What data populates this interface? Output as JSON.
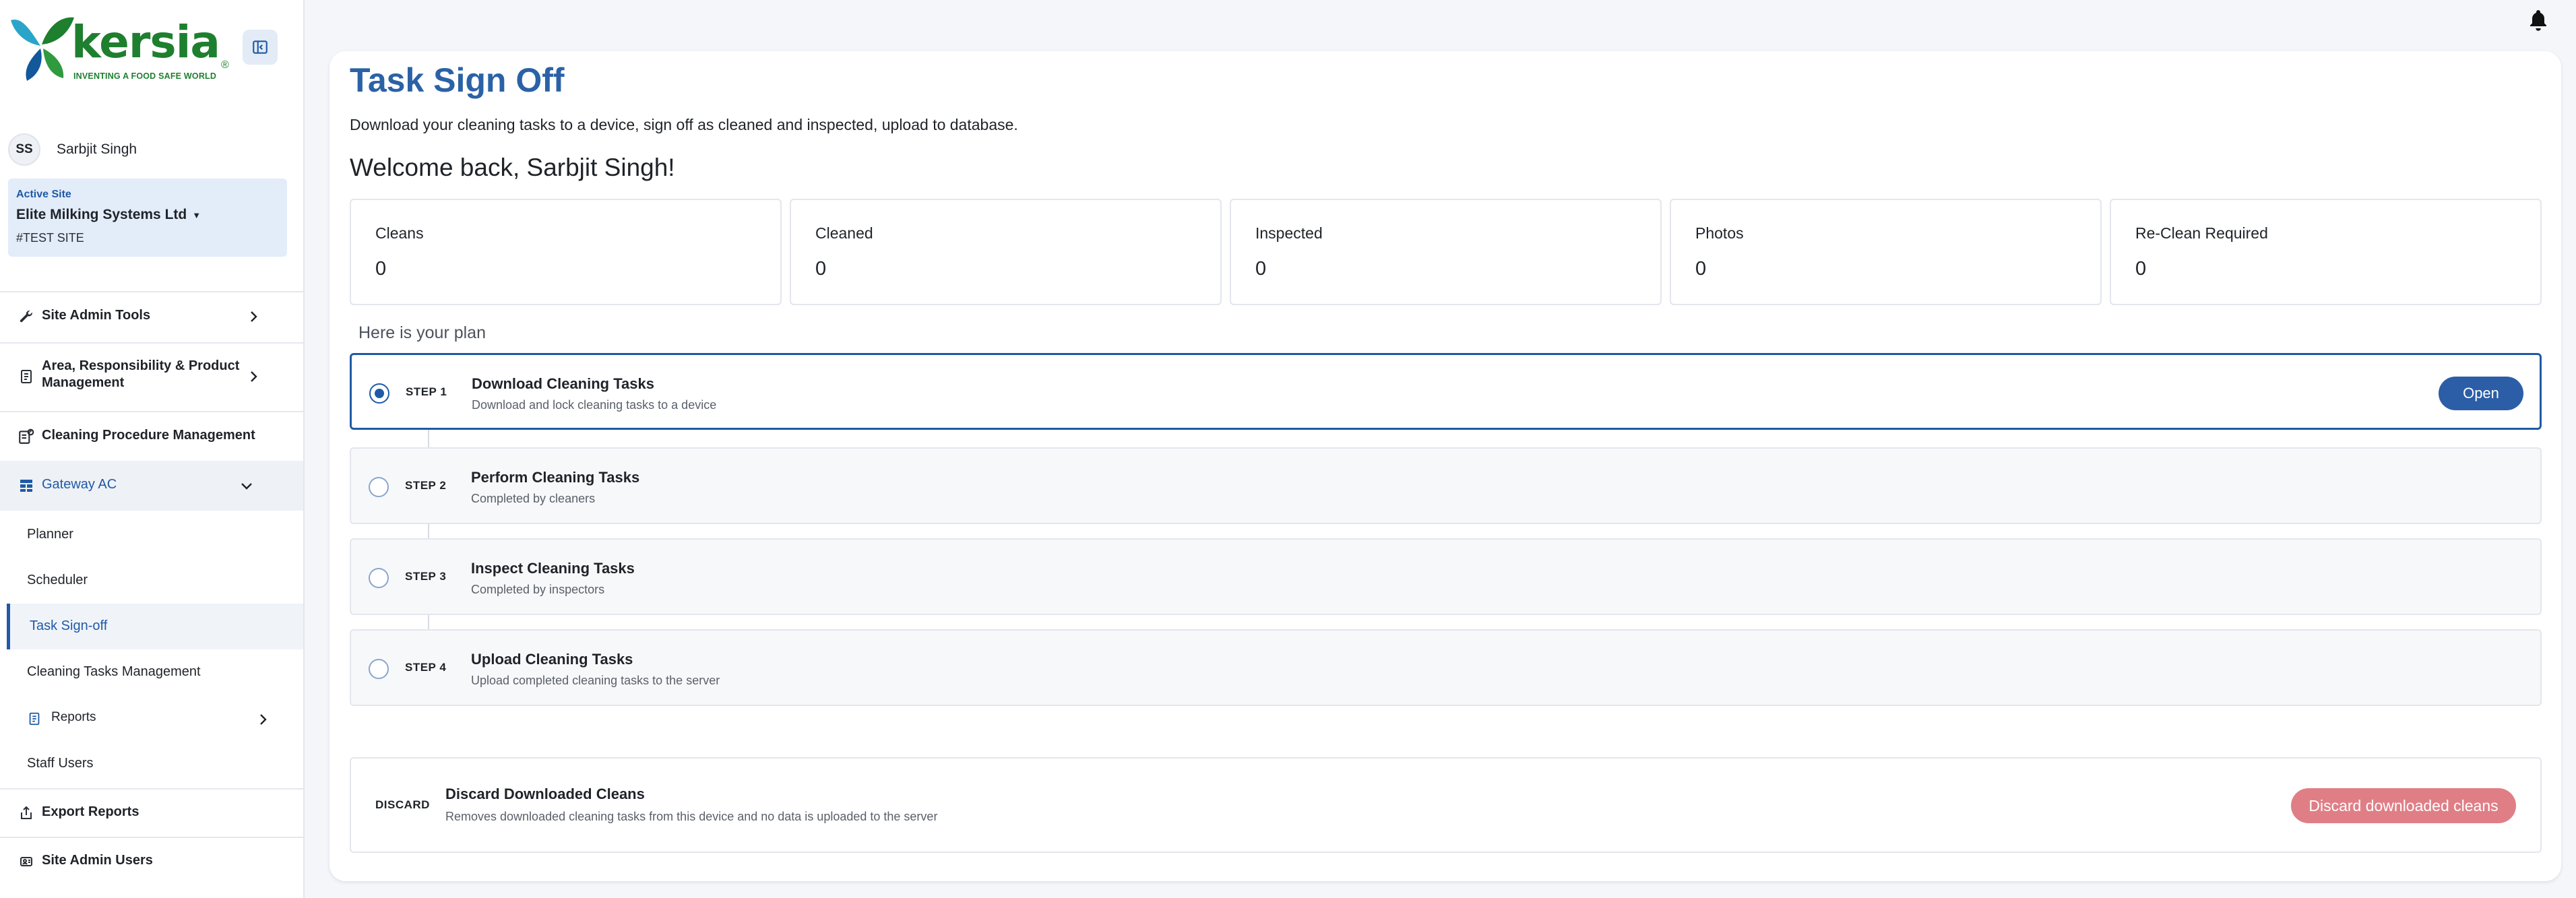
{
  "brand": {
    "logo_text": "kersia",
    "logo_reg": "®",
    "tagline": "INVENTING A FOOD SAFE WORLD",
    "colors": {
      "green": "#1e7f2f",
      "blue": "#1f5aa6",
      "leaf_light": "#2aa5c9",
      "leaf_dark": "#12589a"
    }
  },
  "sidebar": {
    "user": {
      "initials": "SS",
      "name": "Sarbjit Singh"
    },
    "site": {
      "label": "Active Site",
      "name": "Elite Milking Systems Ltd",
      "code": "#TEST SITE"
    },
    "items": [
      {
        "label": "Site Admin Tools",
        "icon": "wrench-icon"
      },
      {
        "label": "Area, Responsibility & Product",
        "label2": "Management",
        "icon": "document-icon"
      },
      {
        "label": "Cleaning Procedure Management",
        "icon": "procedure-icon"
      },
      {
        "label": "Gateway AC",
        "icon": "grid-icon"
      }
    ],
    "sub_items": [
      {
        "label": "Planner"
      },
      {
        "label": "Scheduler"
      },
      {
        "label": "Task Sign-off"
      },
      {
        "label": "Cleaning Tasks Management"
      },
      {
        "label": "Reports"
      },
      {
        "label": "Staff Users"
      }
    ],
    "bottom_items": [
      {
        "label": "Export Reports",
        "icon": "export-icon"
      },
      {
        "label": "Site Admin Users",
        "icon": "users-icon"
      }
    ]
  },
  "main": {
    "title": "Task Sign Off",
    "description": "Download your cleaning tasks to a device, sign off as cleaned and inspected, upload to database.",
    "welcome": "Welcome back, Sarbjit Singh!",
    "stats": [
      {
        "label": "Cleans",
        "value": "0"
      },
      {
        "label": "Cleaned",
        "value": "0"
      },
      {
        "label": "Inspected",
        "value": "0"
      },
      {
        "label": "Photos",
        "value": "0"
      },
      {
        "label": "Re-Clean Required",
        "value": "0"
      }
    ],
    "plan_label": "Here is your plan",
    "steps": [
      {
        "step": "STEP 1",
        "title": "Download Cleaning Tasks",
        "subtitle": "Download and lock cleaning tasks to a device",
        "action": "Open"
      },
      {
        "step": "STEP 2",
        "title": "Perform Cleaning Tasks",
        "subtitle": "Completed by cleaners"
      },
      {
        "step": "STEP 3",
        "title": "Inspect Cleaning Tasks",
        "subtitle": "Completed by inspectors"
      },
      {
        "step": "STEP 4",
        "title": "Upload Cleaning Tasks",
        "subtitle": "Upload completed cleaning tasks to the server"
      }
    ],
    "discard": {
      "tag": "DISCARD",
      "title": "Discard Downloaded Cleans",
      "subtitle": "Removes downloaded cleaning tasks from this device and no data is uploaded to the server",
      "button": "Discard downloaded cleans"
    }
  }
}
